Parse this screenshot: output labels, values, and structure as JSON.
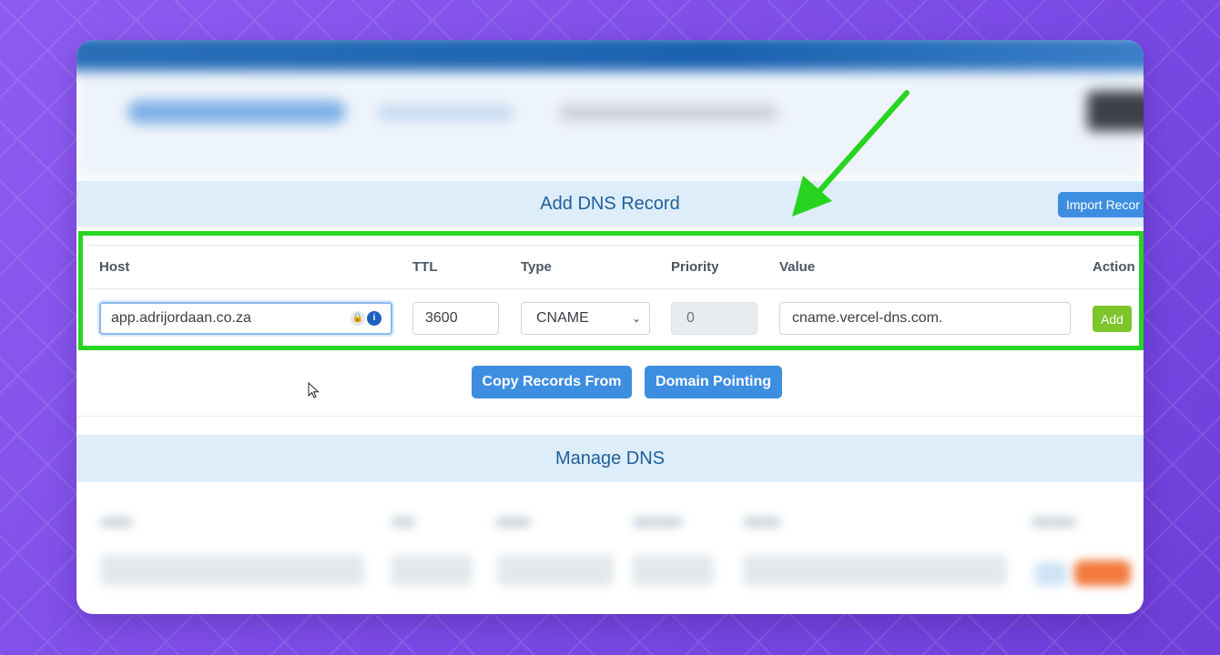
{
  "add_section": {
    "title": "Add DNS Record",
    "import_button": "Import Recor"
  },
  "form": {
    "headers": [
      "Host",
      "TTL",
      "Type",
      "Priority",
      "Value",
      "Action"
    ],
    "host_value": "app.adrijordaan.co.za",
    "ttl_value": "3600",
    "type_value": "CNAME",
    "priority_value": "0",
    "value_value": "cname.vercel-dns.com.",
    "add_button": "Add"
  },
  "actions": {
    "copy_records": "Copy Records From",
    "domain_pointing": "Domain Pointing"
  },
  "manage_section": {
    "title": "Manage DNS"
  },
  "annotation": {
    "highlight_color": "#27d41f",
    "arrow_color": "#27d41f"
  },
  "colors": {
    "primary_button": "#3d8ee0",
    "add_button": "#7cc62b",
    "section_header_bg": "#ddedf9"
  }
}
